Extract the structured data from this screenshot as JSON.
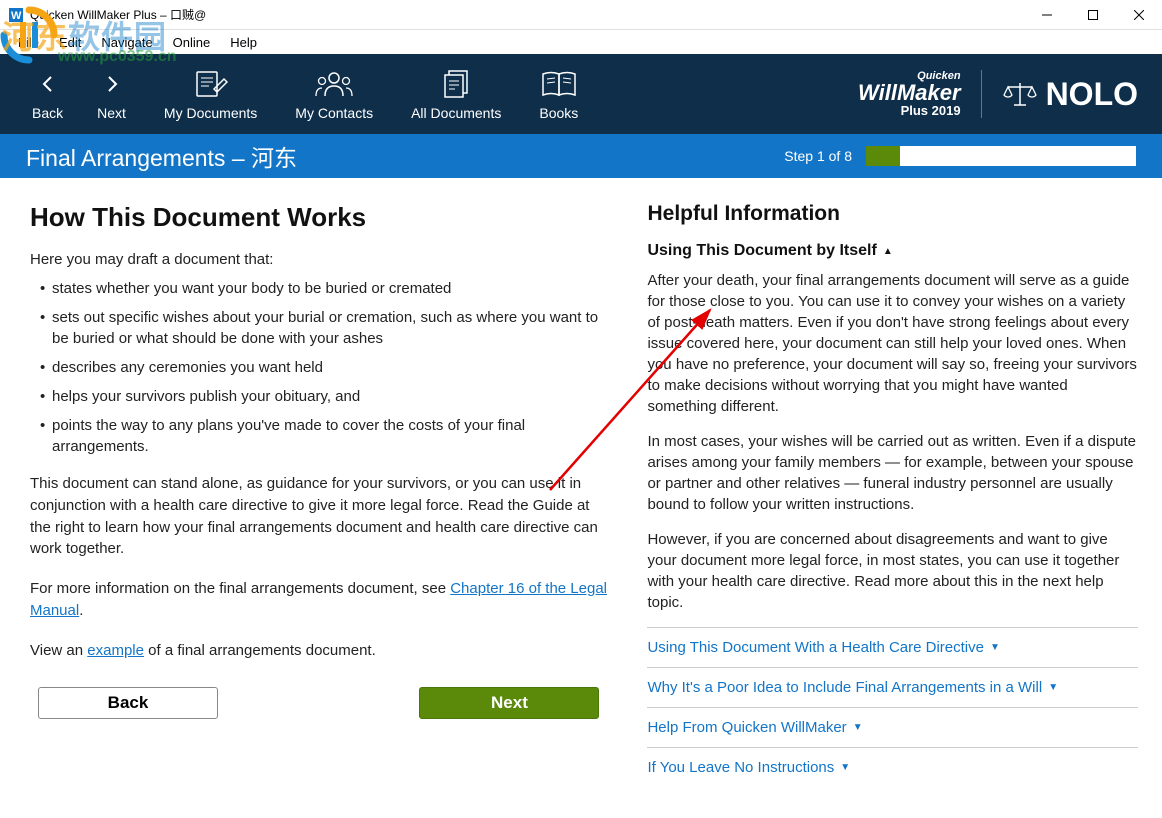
{
  "window": {
    "title": "Quicken WillMaker Plus – 口贼@"
  },
  "menubar": [
    "File",
    "Edit",
    "Navigate",
    "Online",
    "Help"
  ],
  "toolbar": {
    "back": "Back",
    "next": "Next",
    "my_documents": "My Documents",
    "my_contacts": "My Contacts",
    "all_documents": "All Documents",
    "books": "Books",
    "brand_quicken": "Quicken",
    "brand_willmaker": "WillMaker",
    "brand_plus": "Plus 2019",
    "brand_nolo": "NOLO"
  },
  "pagebar": {
    "title": "Final Arrangements – 河东",
    "step": "Step 1 of 8"
  },
  "main": {
    "heading": "How This Document Works",
    "intro": "Here you may draft a document that:",
    "bullets": [
      "states whether you want your body to be buried or cremated",
      "sets out specific wishes about your burial or cremation, such as where you want to be buried or what should be done with your ashes",
      "describes any ceremonies you want held",
      "helps your survivors publish your obituary, and",
      "points the way to any plans you've made to cover the costs of your final arrangements."
    ],
    "para1": "This document can stand alone, as guidance for your survivors, or you can use it in conjunction with a health care directive to give it more legal force. Read the Guide at the right to learn how your final arrangements document and health care directive can work together.",
    "para2_pre": "For more information on the final arrangements document, see ",
    "para2_link": "Chapter 16 of the Legal Manual",
    "para2_post": ".",
    "para3_pre": "View an ",
    "para3_link": "example",
    "para3_post": " of a final arrangements document.",
    "back_btn": "Back",
    "next_btn": "Next"
  },
  "help": {
    "heading": "Helpful Information",
    "topic_title": "Using This Document by Itself",
    "body1": "After your death, your final arrangements document will serve as a guide for those close to you. You can use it to convey your wishes on a variety of post-death matters. Even if you don't have strong feelings about every issue covered here, your document can still help your loved ones. When you have no preference, your document will say so, freeing your survivors to make decisions without worrying that you might have wanted something different.",
    "body2": "In most cases, your wishes will be carried out as written. Even if a dispute arises among your family members — for example, between your spouse or partner and other relatives — funeral industry personnel are usually bound to follow your written instructions.",
    "body3": "However, if you are concerned about disagreements and want to give your document more legal force, in most states, you can use it together with your health care directive. Read more about this in the next help topic.",
    "links": [
      "Using This Document With a Health Care Directive",
      "Why It's a Poor Idea to Include Final Arrangements in a Will",
      "Help From Quicken WillMaker",
      "If You Leave No Instructions"
    ]
  },
  "watermark": {
    "text1": "河东",
    "text2": "软件园",
    "url": "www.pc0359.cn"
  }
}
